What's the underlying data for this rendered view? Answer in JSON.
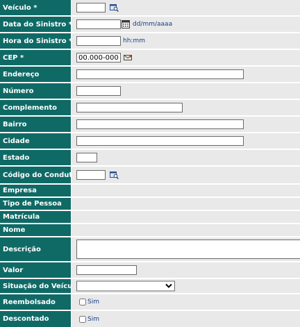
{
  "fields": {
    "veiculo": {
      "label": "Veículo *",
      "value": ""
    },
    "data_sinistro": {
      "label": "Data do Sinistro *",
      "value": "",
      "hint": "dd/mm/aaaa"
    },
    "hora_sinistro": {
      "label": "Hora do Sinistro *",
      "value": "",
      "hint": "hh:mm"
    },
    "cep": {
      "label": "CEP *",
      "value": "00.000-000"
    },
    "endereco": {
      "label": "Endereço",
      "value": ""
    },
    "numero": {
      "label": "Número",
      "value": ""
    },
    "complemento": {
      "label": "Complemento",
      "value": ""
    },
    "bairro": {
      "label": "Bairro",
      "value": ""
    },
    "cidade": {
      "label": "Cidade",
      "value": ""
    },
    "estado": {
      "label": "Estado",
      "value": ""
    },
    "codigo_condutor": {
      "label": "Código do Condutor *",
      "value": ""
    },
    "empresa": {
      "label": "Empresa"
    },
    "tipo_pessoa": {
      "label": "Tipo de Pessoa"
    },
    "matricula": {
      "label": "Matrícula"
    },
    "nome": {
      "label": "Nome"
    },
    "descricao": {
      "label": "Descrição",
      "value": ""
    },
    "valor": {
      "label": "Valor",
      "value": ""
    },
    "situacao_veiculo": {
      "label": "Situação do Veículo",
      "selected": ""
    },
    "reembolsado": {
      "label": "Reembolsado",
      "option": "Sim",
      "checked": false
    },
    "descontado": {
      "label": "Descontado",
      "option": "Sim",
      "checked": false
    }
  },
  "icons": {
    "lookup": "search-lookup-icon",
    "calendar": "calendar-icon",
    "cep_lookup": "cep-lookup-icon"
  },
  "colors": {
    "label_bg": "#0f6a66",
    "label_text": "#ffffff",
    "field_bg": "#e9e9e9",
    "hint_text": "#153d8a"
  }
}
